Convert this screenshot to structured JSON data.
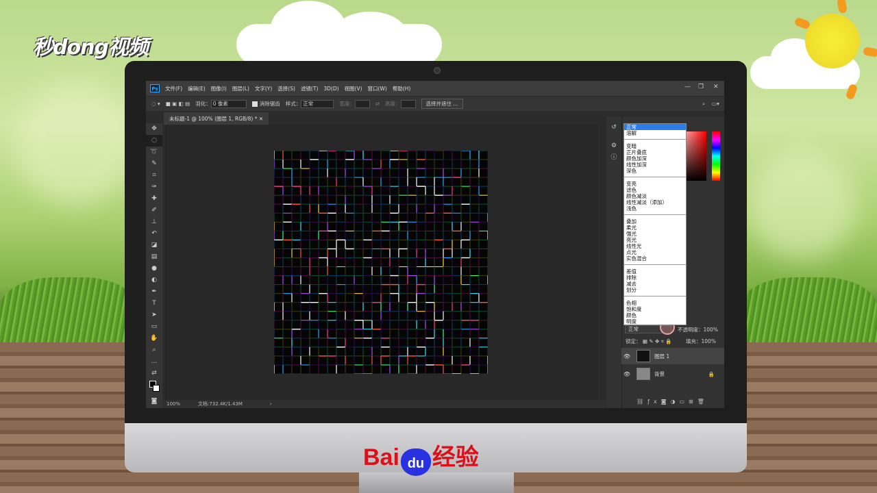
{
  "watermark": {
    "brand": "秒dong视频"
  },
  "ps": {
    "menu": [
      "文件(F)",
      "编辑(E)",
      "图像(I)",
      "图层(L)",
      "文字(Y)",
      "选择(S)",
      "滤镜(T)",
      "3D(D)",
      "视图(V)",
      "窗口(W)",
      "帮助(H)"
    ],
    "options": {
      "feather_label": "羽化：",
      "feather_value": "0 像素",
      "antialias_label": "消除锯齿",
      "style_label": "样式：",
      "style_value": "正常",
      "width_label": "宽度：",
      "height_label": "高度：",
      "select_mask_button": "选择并遮住 ..."
    },
    "document_tab": "未标题-1 @ 100% (图层 1, RGB/8) *",
    "status": {
      "zoom": "100%",
      "doc_info": "文档:732.4K/1.43M",
      "arrow": "›"
    },
    "blend_modes": [
      [
        "正常",
        "溶解"
      ],
      [
        "变暗",
        "正片叠底",
        "颜色加深",
        "线性加深",
        "深色"
      ],
      [
        "变亮",
        "滤色",
        "颜色减淡",
        "线性减淡（添加）",
        "浅色"
      ],
      [
        "叠加",
        "柔光",
        "强光",
        "亮光",
        "线性光",
        "点光",
        "实色混合"
      ],
      [
        "差值",
        "排除",
        "减去",
        "划分"
      ],
      [
        "色相",
        "饱和度",
        "颜色",
        "明度"
      ]
    ],
    "blend_selected": "正常",
    "opacity_label": "不透明度：",
    "opacity_value": "100%",
    "lock_label": "锁定：",
    "fill_label": "填充：",
    "fill_value": "100%",
    "layers": [
      {
        "name": "图层 1"
      },
      {
        "name": "背景"
      }
    ]
  },
  "bottom_brand": {
    "bai": "Bai",
    "du": "du",
    "suffix": "经验"
  }
}
